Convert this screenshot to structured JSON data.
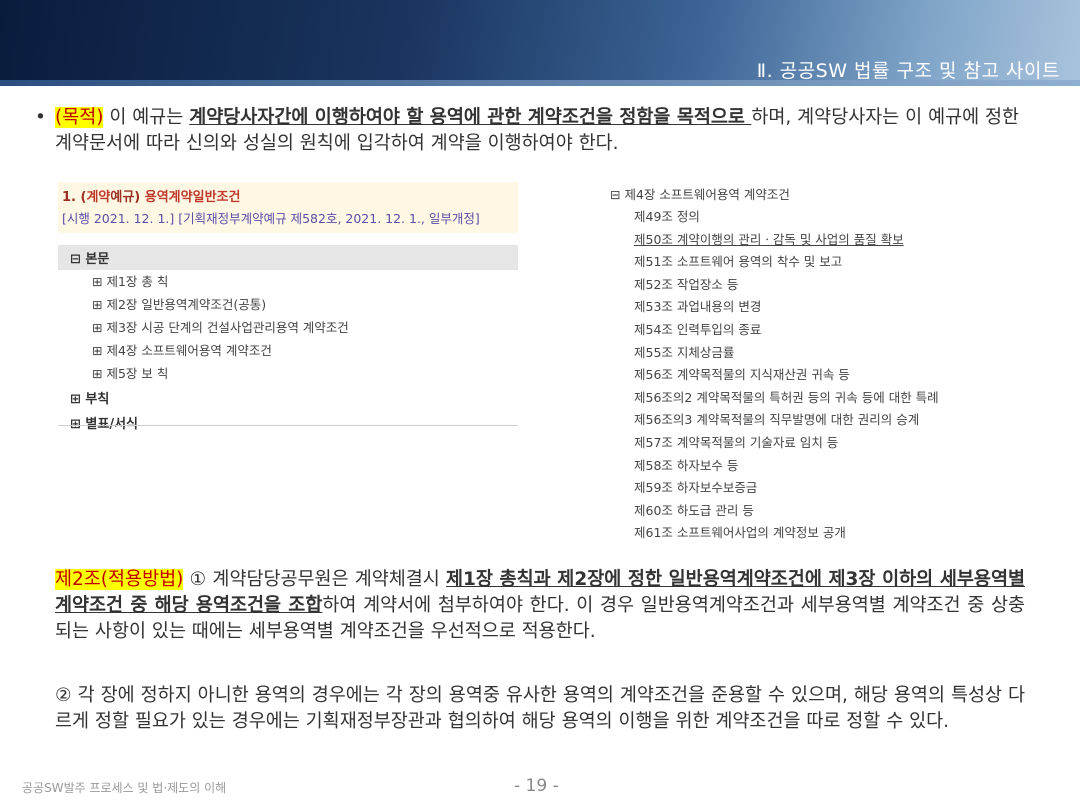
{
  "header": {
    "title": "Ⅱ. 공공SW 법률 구조 및 참고 사이트"
  },
  "purpose": {
    "bullet": "•",
    "label": "(목적)",
    "t1": " 이 예규는 ",
    "bold": "계약당사자간에 이행하여야 할 용역에 관한 계약조건을 정함을 목적으로 ",
    "t2": "하며, 계약당사자는 이 예규에 정한 계약문서에 따라 신의와 성실의 원칙에 입각하여 계약을 이행하여야 한다."
  },
  "left_panel": {
    "title_prefix": "1. (",
    "title_key": "계약",
    "title_mid": "예규) ",
    "title_main": "용역계약일반조건",
    "date": "[시행 2021. 12. 1.] [기획재정부계약예규 제582호, 2021. 12. 1., 일부개정]",
    "root": "⊟ 본문",
    "items": [
      "⊞ 제1장 총 칙",
      "⊞ 제2장 일반용역계약조건(공통)",
      "⊞ 제3장 시공 단계의 건설사업관리용역 계약조건",
      "⊞ 제4장 소프트웨어용역 계약조건",
      "⊞ 제5장 보 칙"
    ],
    "items2": [
      "⊞ 부칙",
      "⊞ 별표/서식"
    ]
  },
  "right_panel": {
    "root": "⊟ 제4장 소프트웨어용역 계약조건",
    "items": [
      "제49조 정의",
      "제50조 계약이행의 관리ㆍ감독 및 사업의 품질 확보",
      "제51조 소프트웨어 용역의 착수 및 보고",
      "제52조 작업장소 등",
      "제53조 과업내용의 변경",
      "제54조 인력투입의 종료",
      "제55조 지체상금률",
      "제56조 계약목적물의 지식재산권 귀속 등",
      "제56조의2 계약목적물의 특허권 등의 귀속 등에 대한 특례",
      "제56조의3 계약목적물의 직무발명에 대한 권리의 승계",
      "제57조 계약목적물의 기술자료 임치 등",
      "제58조 하자보수 등",
      "제59조 하자보수보증금",
      "제60조 하도급 관리 등",
      "제61조 소프트웨어사업의 계약정보 공개"
    ]
  },
  "article2": {
    "label": "제2조(적용방법)",
    "t1": " ① 계약담당공무원은 계약체결시 ",
    "bold": "제1장 총칙과 제2장에 정한 일반용역계약조건에 제3장 이하의 세부용역별 계약조건 중 해당 용역조건을 조합",
    "t2": "하여 계약서에 첨부하여야 한다. 이 경우 일반용역계약조건과 세부용역별 계약조건 중 상충되는 사항이 있는 때에는 세부용역별 계약조건을 우선적으로 적용한다.",
    "p2": "② 각 장에 정하지 아니한 용역의 경우에는 각 장의 용역중 유사한 용역의 계약조건을 준용할 수 있으며, 해당 용역의 특성상 다르게 정할 필요가 있는 경우에는 기획재정부장관과 협의하여 해당 용역의 이행을 위한 계약조건을 따로 정할 수 있다."
  },
  "footer": {
    "left": "공공SW발주 프로세스 및 법·제도의 이해",
    "page": "- 19 -"
  }
}
